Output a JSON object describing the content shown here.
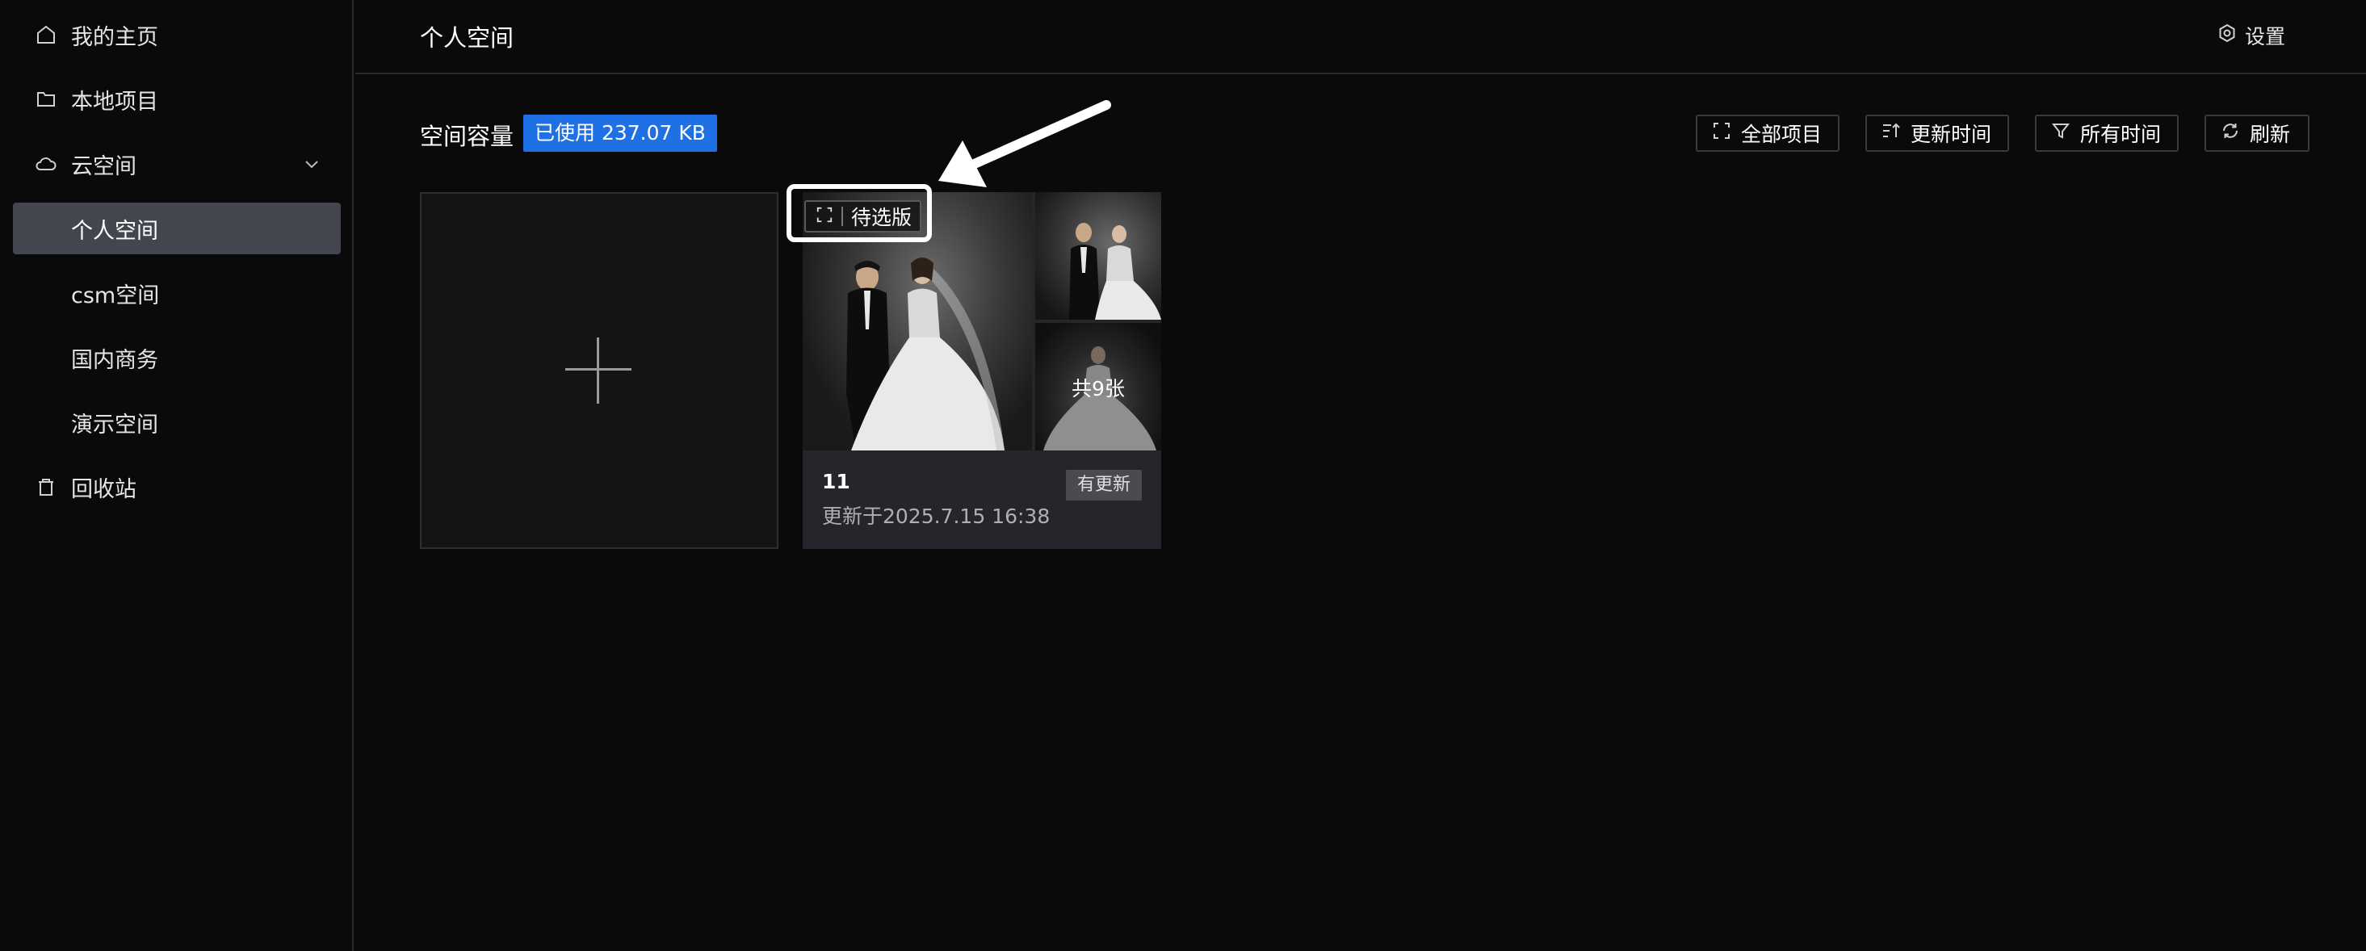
{
  "sidebar": {
    "items": [
      {
        "label": "我的主页",
        "icon": "home-icon"
      },
      {
        "label": "本地项目",
        "icon": "folder-icon"
      },
      {
        "label": "云空间",
        "icon": "cloud-icon"
      },
      {
        "label": "个人空间",
        "active": true
      },
      {
        "label": "csm空间"
      },
      {
        "label": "国内商务"
      },
      {
        "label": "演示空间"
      },
      {
        "label": "回收站",
        "icon": "trash-icon"
      }
    ]
  },
  "header": {
    "title": "个人空间",
    "settings_label": "设置"
  },
  "toolbar": {
    "capacity_label": "空间容量",
    "capacity_badge": "已使用 237.07 KB",
    "buttons": [
      {
        "label": "全部项目",
        "icon": "select-icon"
      },
      {
        "label": "更新时间",
        "icon": "sort-icon"
      },
      {
        "label": "所有时间",
        "icon": "filter-icon"
      },
      {
        "label": "刷新",
        "icon": "refresh-icon"
      }
    ]
  },
  "project": {
    "status_tag": "待选版",
    "photo_count": "共9张",
    "title": "11",
    "updated": "更新于2025.7.15 16:38",
    "update_badge": "有更新"
  },
  "colors": {
    "accent": "#1f6fe5",
    "background": "#0a0a0a",
    "active_item": "#43464f",
    "card": "#25262b"
  }
}
